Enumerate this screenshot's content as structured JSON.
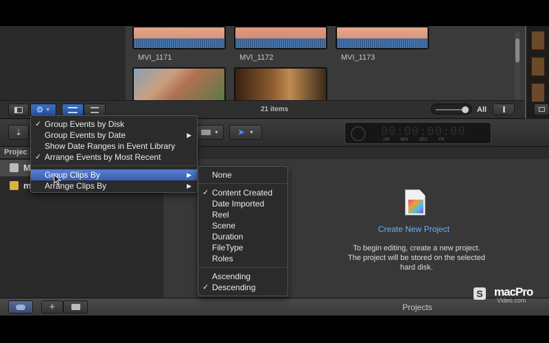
{
  "browser": {
    "clips": [
      {
        "name": "MVI_1171"
      },
      {
        "name": "MVI_1172"
      },
      {
        "name": "MVI_1173"
      }
    ],
    "items_count": "21 items",
    "filter_label": "All"
  },
  "sidebar": {
    "header": "Projec",
    "rows": [
      {
        "label": "M"
      },
      {
        "label": "m"
      }
    ]
  },
  "timecode": {
    "digits": "00:00:00:00",
    "units": [
      "HR",
      "MIN",
      "SEC",
      "FR"
    ]
  },
  "project_area": {
    "create_link": "Create New Project",
    "description_line1": "To begin editing, create a new project.",
    "description_line2": "The project will be stored on the selected",
    "description_line3": "hard disk."
  },
  "bottom_bar": {
    "title": "Projects"
  },
  "watermark": {
    "brand": "macPro",
    "sub": "Video.com"
  },
  "action_menu": {
    "items": [
      {
        "label": "Group Events by Disk",
        "checked": true,
        "submenu": false
      },
      {
        "label": "Group Events by Date",
        "checked": false,
        "submenu": true
      },
      {
        "label": "Show Date Ranges in Event Library",
        "checked": false,
        "submenu": false
      },
      {
        "label": "Arrange Events by Most Recent",
        "checked": true,
        "submenu": false
      },
      {
        "label": "Group Clips By",
        "checked": false,
        "submenu": true,
        "highlighted": true
      },
      {
        "label": "Arrange Clips By",
        "checked": false,
        "submenu": true
      }
    ]
  },
  "group_clips_submenu": {
    "items": [
      {
        "label": "None",
        "checked": false
      },
      {
        "label": "Content Created",
        "checked": true
      },
      {
        "label": "Date Imported",
        "checked": false
      },
      {
        "label": "Reel",
        "checked": false
      },
      {
        "label": "Scene",
        "checked": false
      },
      {
        "label": "Duration",
        "checked": false
      },
      {
        "label": "FileType",
        "checked": false
      },
      {
        "label": "Roles",
        "checked": false
      },
      {
        "label": "Ascending",
        "checked": false
      },
      {
        "label": "Descending",
        "checked": true
      }
    ]
  },
  "colors": {
    "accent": "#3c5fb0",
    "link": "#6ab0ff"
  }
}
